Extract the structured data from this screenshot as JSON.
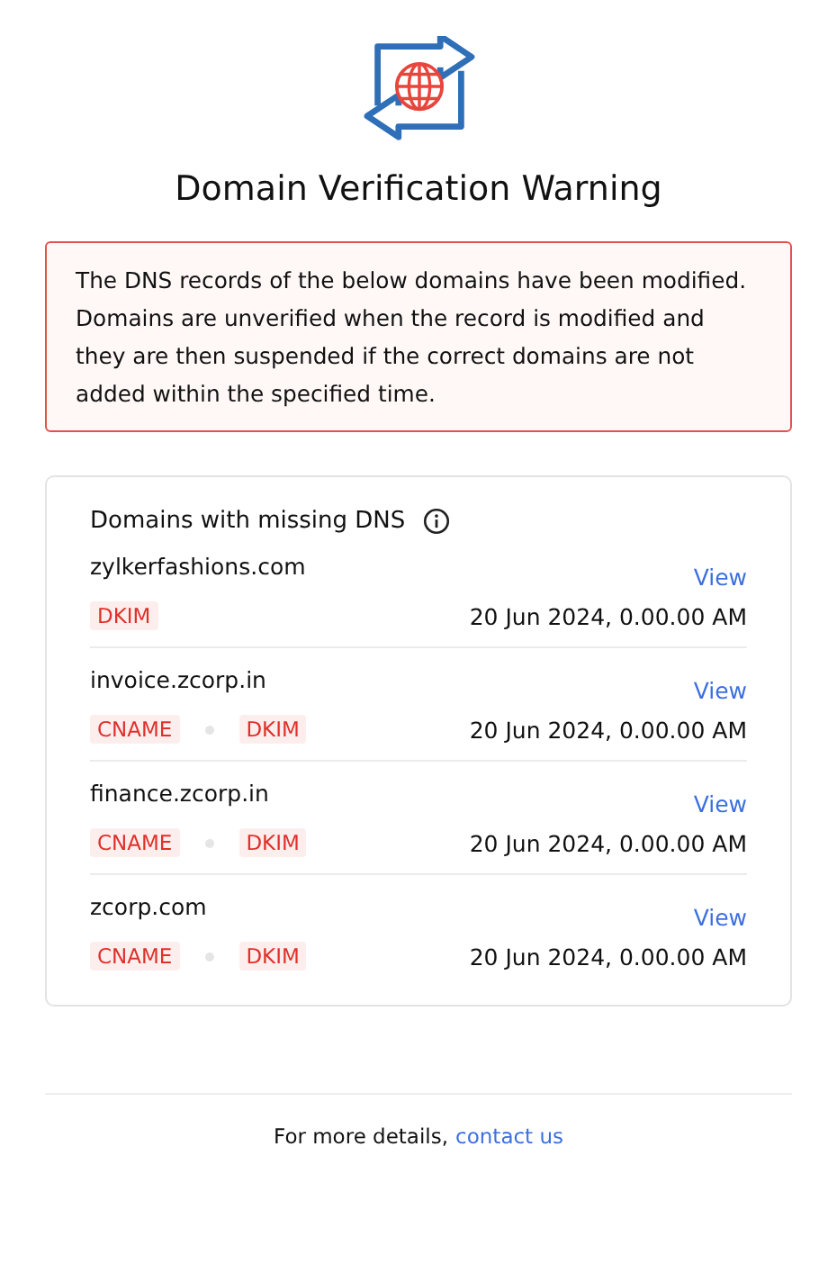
{
  "title": "Domain Verification Warning",
  "warning": "The DNS records of the below domains have been modified. Domains are unverified when the record is modified and they are then suspended if the correct domains are not added within the specified time.",
  "card": {
    "heading": "Domains with missing DNS",
    "domains": [
      {
        "name": "zylkerfashions.com",
        "action": "View",
        "records": [
          "DKIM"
        ],
        "date": "20 Jun 2024, 0.00.00 AM"
      },
      {
        "name": "invoice.zcorp.in",
        "action": "View",
        "records": [
          "CNAME",
          "DKIM"
        ],
        "date": "20 Jun 2024, 0.00.00 AM"
      },
      {
        "name": "finance.zcorp.in",
        "action": "View",
        "records": [
          "CNAME",
          "DKIM"
        ],
        "date": "20 Jun 2024, 0.00.00 AM"
      },
      {
        "name": "zcorp.com",
        "action": "View",
        "records": [
          "CNAME",
          "DKIM"
        ],
        "date": "20 Jun 2024, 0.00.00 AM"
      }
    ]
  },
  "footer": {
    "text": "For more details,",
    "link": "contact us"
  }
}
